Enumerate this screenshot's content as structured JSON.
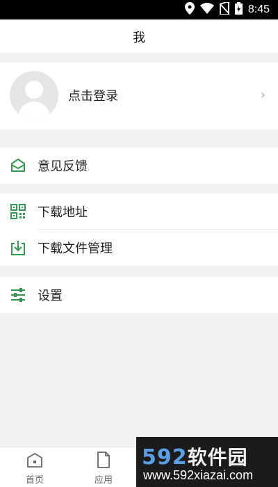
{
  "status": {
    "time": "8:45",
    "icons": [
      "location-icon",
      "wifi-icon",
      "no-sim-icon",
      "battery-icon"
    ]
  },
  "header": {
    "title": "我"
  },
  "profile": {
    "login_label": "点击登录",
    "chevron": "›"
  },
  "menu": {
    "group1": [
      {
        "label": "意见反馈",
        "icon": "mail-icon"
      }
    ],
    "group2": [
      {
        "label": "下载地址",
        "icon": "qr-code-icon"
      },
      {
        "label": "下载文件管理",
        "icon": "download-icon"
      }
    ],
    "group3": [
      {
        "label": "设置",
        "icon": "sliders-icon"
      }
    ]
  },
  "tabbar": {
    "tabs": [
      {
        "label": "首页",
        "icon": "home-icon"
      },
      {
        "label": "应用",
        "icon": "file-icon"
      }
    ]
  },
  "watermark": {
    "logo_num": "592",
    "logo_text": "软件园",
    "url": "www.592xiazai.com"
  },
  "colors": {
    "accent": "#2e9b4f",
    "background": "#f2f2f2"
  }
}
